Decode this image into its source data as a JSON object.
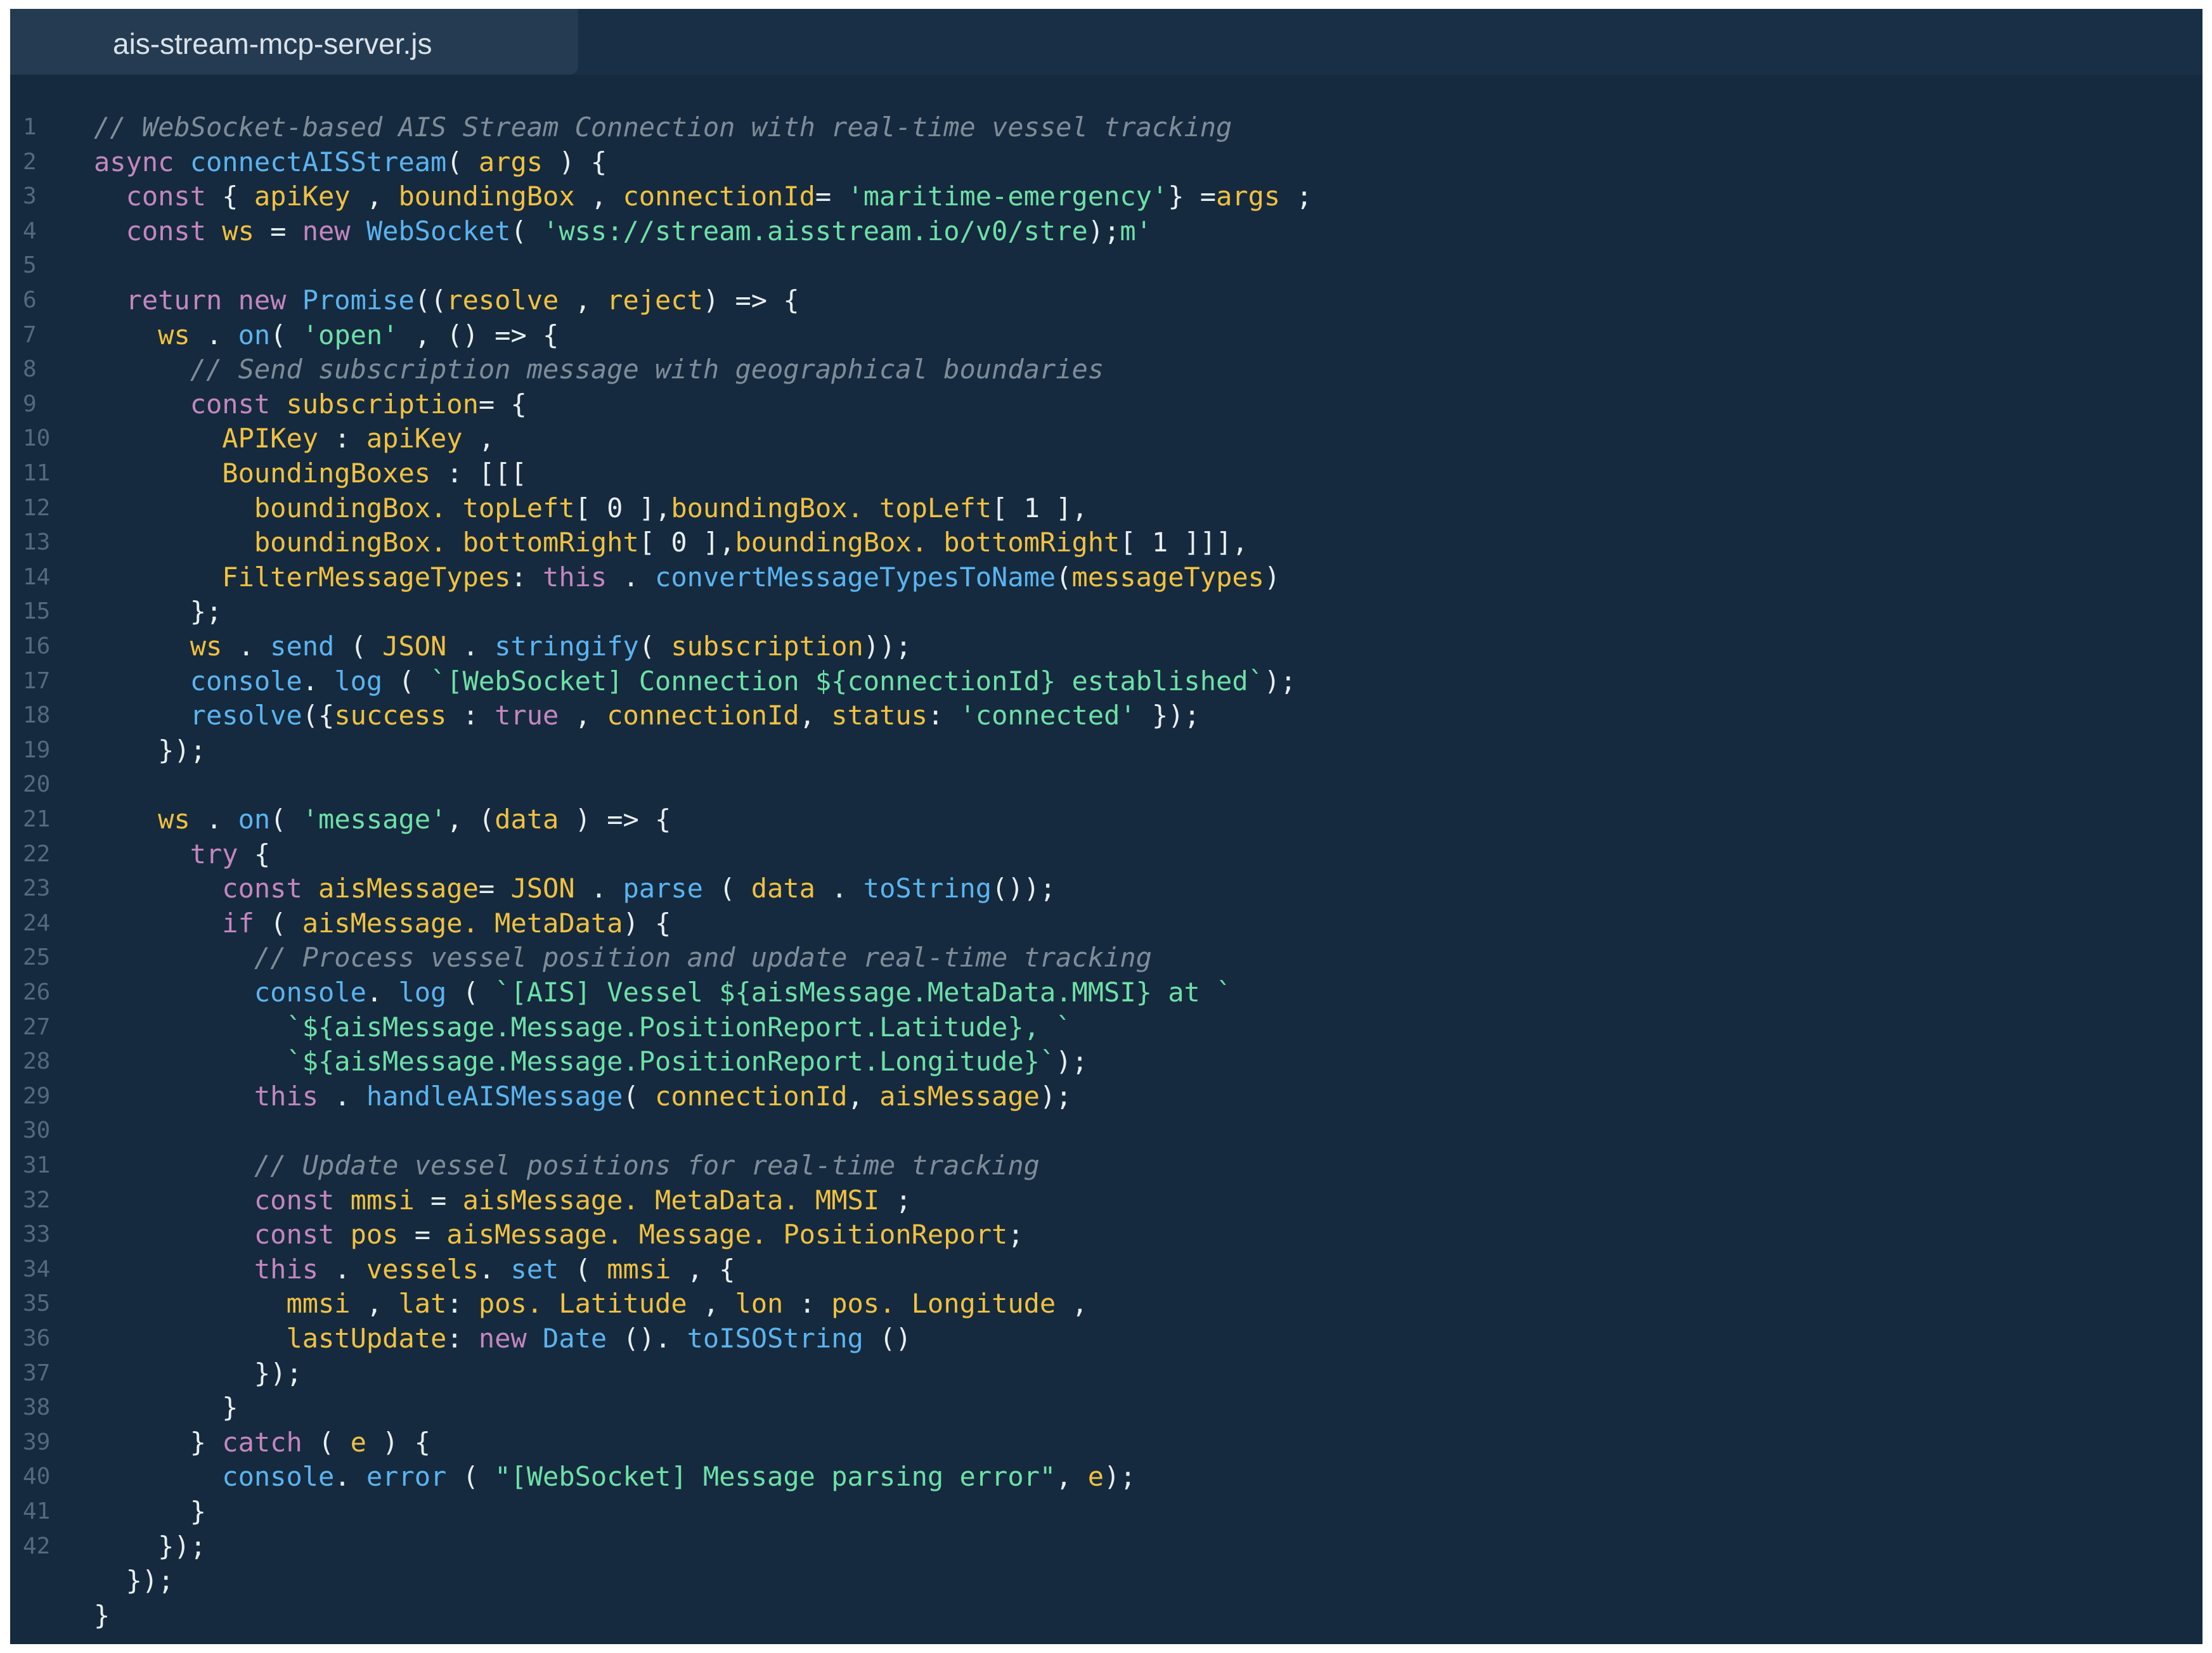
{
  "editor": {
    "tab_title": "ais-stream-mcp-server.js",
    "colors": {
      "background": "#152a3e",
      "tab_background": "#243b52",
      "comment": "#7f8c99",
      "keyword": "#c586c0",
      "function": "#5bb4f0",
      "variable": "#f2c13f",
      "string": "#6ee0a8",
      "punctuation": "#e8eef3",
      "line_number": "#56697c"
    }
  },
  "code_lines": [
    {
      "n": "1",
      "segs": [
        [
          "c",
          "// WebSocket-based AIS Stream Connection with real-time vessel tracking"
        ]
      ]
    },
    {
      "n": "2",
      "segs": [
        [
          "k",
          "async "
        ],
        [
          "f",
          "connectAISStream"
        ],
        [
          "p",
          "( "
        ],
        [
          "v",
          "args"
        ],
        [
          "p",
          " ) {"
        ]
      ]
    },
    {
      "n": "3",
      "segs": [
        [
          "p",
          "  "
        ],
        [
          "k",
          "const "
        ],
        [
          "p",
          "{ "
        ],
        [
          "v",
          "apiKey"
        ],
        [
          "p",
          " , "
        ],
        [
          "v",
          "boundingBox"
        ],
        [
          "p",
          " , "
        ],
        [
          "v",
          "connectionId"
        ],
        [
          "p",
          "= "
        ],
        [
          "s",
          "'maritime-emergency'"
        ],
        [
          "p",
          "} ="
        ],
        [
          "v",
          "args"
        ],
        [
          "p",
          " ;"
        ]
      ]
    },
    {
      "n": "4",
      "segs": [
        [
          "p",
          "  "
        ],
        [
          "k",
          "const "
        ],
        [
          "v",
          "ws"
        ],
        [
          "p",
          " = "
        ],
        [
          "k",
          "new "
        ],
        [
          "f",
          "WebSocket"
        ],
        [
          "p",
          "( "
        ],
        [
          "s",
          "'wss://stream.aisstream.io/v0/stre"
        ],
        [
          "p",
          ");"
        ],
        [
          "s",
          "m'"
        ]
      ]
    },
    {
      "n": "5",
      "segs": []
    },
    {
      "n": "6",
      "segs": [
        [
          "p",
          "  "
        ],
        [
          "k",
          "return new "
        ],
        [
          "f",
          "Promise"
        ],
        [
          "p",
          "(("
        ],
        [
          "v",
          "resolve"
        ],
        [
          "p",
          " , "
        ],
        [
          "v",
          "reject"
        ],
        [
          "p",
          ") => {"
        ]
      ]
    },
    {
      "n": "7",
      "segs": [
        [
          "p",
          "    "
        ],
        [
          "v",
          "ws"
        ],
        [
          "p",
          " . "
        ],
        [
          "f",
          "on"
        ],
        [
          "p",
          "( "
        ],
        [
          "s",
          "'open'"
        ],
        [
          "p",
          " , () => {"
        ]
      ]
    },
    {
      "n": "8",
      "segs": [
        [
          "p",
          "      "
        ],
        [
          "c",
          "// Send subscription message with geographical boundaries"
        ]
      ]
    },
    {
      "n": "9",
      "segs": [
        [
          "p",
          "      "
        ],
        [
          "k",
          "const "
        ],
        [
          "v",
          "subscription"
        ],
        [
          "p",
          "= {"
        ]
      ]
    },
    {
      "n": "10",
      "segs": [
        [
          "p",
          "        "
        ],
        [
          "v",
          "APIKey"
        ],
        [
          "p",
          " : "
        ],
        [
          "v",
          "apiKey"
        ],
        [
          "p",
          " ,"
        ]
      ]
    },
    {
      "n": "11",
      "segs": [
        [
          "p",
          "        "
        ],
        [
          "v",
          "BoundingBoxes"
        ],
        [
          "p",
          " : [[["
        ]
      ]
    },
    {
      "n": "12",
      "segs": [
        [
          "p",
          "          "
        ],
        [
          "v",
          "boundingBox. topLeft"
        ],
        [
          "p",
          "[ 0 ],"
        ],
        [
          "v",
          "boundingBox. topLeft"
        ],
        [
          "p",
          "[ 1 ],"
        ]
      ]
    },
    {
      "n": "13",
      "segs": [
        [
          "p",
          "          "
        ],
        [
          "v",
          "boundingBox. bottomRight"
        ],
        [
          "p",
          "[ 0 ],"
        ],
        [
          "v",
          "boundingBox. bottomRight"
        ],
        [
          "p",
          "[ 1 ]]],"
        ]
      ]
    },
    {
      "n": "14",
      "segs": [
        [
          "p",
          "        "
        ],
        [
          "v",
          "FilterMessageTypes"
        ],
        [
          "p",
          ": "
        ],
        [
          "k",
          "this"
        ],
        [
          "p",
          " . "
        ],
        [
          "f",
          "convertMessageTypesToName"
        ],
        [
          "p",
          "("
        ],
        [
          "v",
          "messageTypes"
        ],
        [
          "p",
          ")"
        ]
      ]
    },
    {
      "n": "15",
      "segs": [
        [
          "p",
          "      };"
        ]
      ]
    },
    {
      "n": "16",
      "segs": [
        [
          "p",
          "      "
        ],
        [
          "v",
          "ws"
        ],
        [
          "p",
          " . "
        ],
        [
          "f",
          "send"
        ],
        [
          "p",
          " ( "
        ],
        [
          "v",
          "JSON"
        ],
        [
          "p",
          " . "
        ],
        [
          "f",
          "stringify"
        ],
        [
          "p",
          "( "
        ],
        [
          "v",
          "subscription"
        ],
        [
          "p",
          "));"
        ]
      ]
    },
    {
      "n": "17",
      "segs": [
        [
          "p",
          "      "
        ],
        [
          "f",
          "console"
        ],
        [
          "p",
          ". "
        ],
        [
          "f",
          "log"
        ],
        [
          "p",
          " ( "
        ],
        [
          "s",
          "`[WebSocket] Connection ${connectionId} established`"
        ],
        [
          "p",
          ");"
        ]
      ]
    },
    {
      "n": "18",
      "segs": [
        [
          "p",
          "      "
        ],
        [
          "f",
          "resolve"
        ],
        [
          "p",
          "({"
        ],
        [
          "v",
          "success"
        ],
        [
          "p",
          " : "
        ],
        [
          "k",
          "true"
        ],
        [
          "p",
          " , "
        ],
        [
          "v",
          "connectionId"
        ],
        [
          "p",
          ", "
        ],
        [
          "v",
          "status"
        ],
        [
          "p",
          ": "
        ],
        [
          "s",
          "'connected'"
        ],
        [
          "p",
          " });"
        ]
      ]
    },
    {
      "n": "19",
      "segs": [
        [
          "p",
          "    });"
        ]
      ]
    },
    {
      "n": "20",
      "segs": []
    },
    {
      "n": "21",
      "segs": [
        [
          "p",
          "    "
        ],
        [
          "v",
          "ws"
        ],
        [
          "p",
          " . "
        ],
        [
          "f",
          "on"
        ],
        [
          "p",
          "( "
        ],
        [
          "s",
          "'message'"
        ],
        [
          "p",
          ", ("
        ],
        [
          "v",
          "data"
        ],
        [
          "p",
          " ) => {"
        ]
      ]
    },
    {
      "n": "22",
      "segs": [
        [
          "p",
          "      "
        ],
        [
          "k",
          "try"
        ],
        [
          "p",
          " {"
        ]
      ]
    },
    {
      "n": "23",
      "segs": [
        [
          "p",
          "        "
        ],
        [
          "k",
          "const "
        ],
        [
          "v",
          "aisMessage"
        ],
        [
          "p",
          "= "
        ],
        [
          "v",
          "JSON"
        ],
        [
          "p",
          " . "
        ],
        [
          "f",
          "parse"
        ],
        [
          "p",
          " ( "
        ],
        [
          "v",
          "data"
        ],
        [
          "p",
          " . "
        ],
        [
          "f",
          "toString"
        ],
        [
          "p",
          "());"
        ]
      ]
    },
    {
      "n": "24",
      "segs": [
        [
          "p",
          "        "
        ],
        [
          "k",
          "if"
        ],
        [
          "p",
          " ( "
        ],
        [
          "v",
          "aisMessage. MetaData"
        ],
        [
          "p",
          ") {"
        ]
      ]
    },
    {
      "n": "25",
      "segs": [
        [
          "p",
          "          "
        ],
        [
          "c",
          "// Process vessel position and update real-time tracking"
        ]
      ]
    },
    {
      "n": "26",
      "segs": [
        [
          "p",
          "          "
        ],
        [
          "f",
          "console"
        ],
        [
          "p",
          ". "
        ],
        [
          "f",
          "log"
        ],
        [
          "p",
          " ( "
        ],
        [
          "s",
          "`[AIS] Vessel ${aisMessage.MetaData.MMSI} at `"
        ]
      ]
    },
    {
      "n": "27",
      "segs": [
        [
          "p",
          "            "
        ],
        [
          "s",
          "`${aisMessage.Message.PositionReport.Latitude}, `"
        ]
      ]
    },
    {
      "n": "28",
      "segs": [
        [
          "p",
          "            "
        ],
        [
          "s",
          "`${aisMessage.Message.PositionReport.Longitude}`"
        ],
        [
          "p",
          ");"
        ]
      ]
    },
    {
      "n": "29",
      "segs": [
        [
          "p",
          "          "
        ],
        [
          "k",
          "this"
        ],
        [
          "p",
          " . "
        ],
        [
          "f",
          "handleAISMessage"
        ],
        [
          "p",
          "( "
        ],
        [
          "v",
          "connectionId"
        ],
        [
          "p",
          ", "
        ],
        [
          "v",
          "aisMessage"
        ],
        [
          "p",
          ");"
        ]
      ]
    },
    {
      "n": "30",
      "segs": []
    },
    {
      "n": "31",
      "segs": [
        [
          "p",
          "          "
        ],
        [
          "c",
          "// Update vessel positions for real-time tracking"
        ]
      ]
    },
    {
      "n": "32",
      "segs": [
        [
          "p",
          "          "
        ],
        [
          "k",
          "const "
        ],
        [
          "v",
          "mmsi"
        ],
        [
          "p",
          " = "
        ],
        [
          "v",
          "aisMessage. MetaData. MMSI"
        ],
        [
          "p",
          " ;"
        ]
      ]
    },
    {
      "n": "33",
      "segs": [
        [
          "p",
          "          "
        ],
        [
          "k",
          "const "
        ],
        [
          "v",
          "pos"
        ],
        [
          "p",
          " = "
        ],
        [
          "v",
          "aisMessage. Message. PositionReport"
        ],
        [
          "p",
          ";"
        ]
      ]
    },
    {
      "n": "34",
      "segs": [
        [
          "p",
          "          "
        ],
        [
          "k",
          "this"
        ],
        [
          "p",
          " . "
        ],
        [
          "v",
          "vessels"
        ],
        [
          "p",
          ". "
        ],
        [
          "f",
          "set"
        ],
        [
          "p",
          " ( "
        ],
        [
          "v",
          "mmsi"
        ],
        [
          "p",
          " , {"
        ]
      ]
    },
    {
      "n": "35",
      "segs": [
        [
          "p",
          "            "
        ],
        [
          "v",
          "mmsi"
        ],
        [
          "p",
          " , "
        ],
        [
          "v",
          "lat"
        ],
        [
          "p",
          ": "
        ],
        [
          "v",
          "pos. Latitude"
        ],
        [
          "p",
          " , "
        ],
        [
          "v",
          "lon"
        ],
        [
          "p",
          " : "
        ],
        [
          "v",
          "pos. Longitude"
        ],
        [
          "p",
          " ,"
        ]
      ]
    },
    {
      "n": "36",
      "segs": [
        [
          "p",
          "            "
        ],
        [
          "v",
          "lastUpdate"
        ],
        [
          "p",
          ": "
        ],
        [
          "k",
          "new "
        ],
        [
          "f",
          "Date"
        ],
        [
          "p",
          " (). "
        ],
        [
          "f",
          "toISOString"
        ],
        [
          "p",
          " ()"
        ]
      ]
    },
    {
      "n": "37",
      "segs": [
        [
          "p",
          "          });"
        ]
      ]
    },
    {
      "n": "38",
      "segs": [
        [
          "p",
          "        }"
        ]
      ]
    },
    {
      "n": "39",
      "segs": [
        [
          "p",
          "      } "
        ],
        [
          "k",
          "catch"
        ],
        [
          "p",
          " ( "
        ],
        [
          "v",
          "e"
        ],
        [
          "p",
          " ) {"
        ]
      ]
    },
    {
      "n": "40",
      "segs": [
        [
          "p",
          "        "
        ],
        [
          "f",
          "console"
        ],
        [
          "p",
          ". "
        ],
        [
          "f",
          "error"
        ],
        [
          "p",
          " ( "
        ],
        [
          "s",
          "\"[WebSocket] Message parsing error\""
        ],
        [
          "p",
          ", "
        ],
        [
          "v",
          "e"
        ],
        [
          "p",
          ");"
        ]
      ]
    },
    {
      "n": "41",
      "segs": [
        [
          "p",
          "      }"
        ]
      ]
    },
    {
      "n": "42",
      "segs": [
        [
          "p",
          "    });"
        ]
      ]
    },
    {
      "n": "",
      "segs": [
        [
          "p",
          "  });"
        ]
      ]
    },
    {
      "n": "",
      "segs": [
        [
          "p",
          "}"
        ]
      ]
    }
  ]
}
